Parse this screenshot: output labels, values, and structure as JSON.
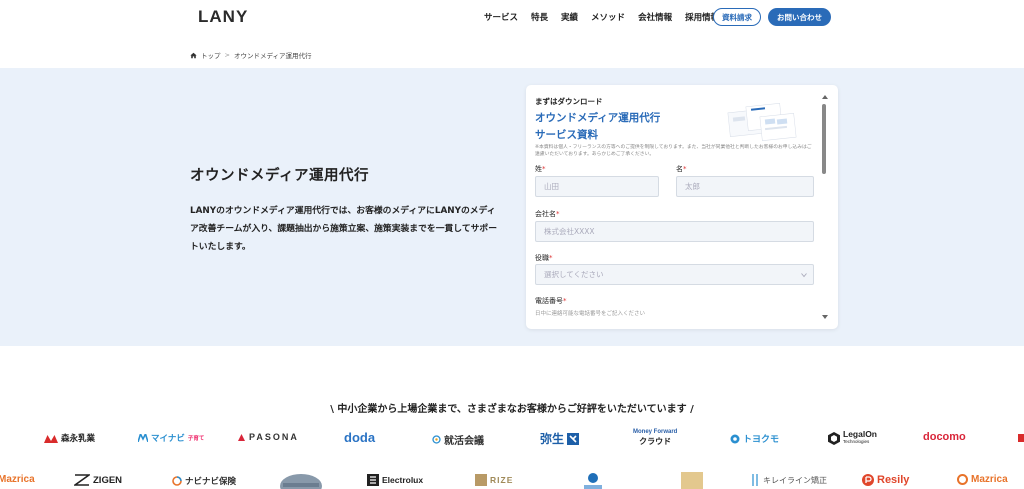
{
  "header": {
    "logo": "LANY",
    "nav": [
      "サービス",
      "特長",
      "実績",
      "メソッド",
      "会社情報",
      "採用情報"
    ],
    "btn_download": "資料請求",
    "btn_contact": "お問い合わせ",
    "accent": "#2a6bb8"
  },
  "breadcrumb": {
    "home": "トップ",
    "separator": ">",
    "current": "オウンドメディア運用代行"
  },
  "hero": {
    "title": "オウンドメディア運用代行",
    "description": "LANYのオウンドメディア運用代行では、お客様のメディアにLANYのメディア改善チームが入り、課題抽出から施策立案、施策実装までを一貫してサポートいたします。",
    "background": "#eaf1fa"
  },
  "form": {
    "kicker": "まずはダウンロード",
    "title_line1": "オウンドメディア運用代行",
    "title_line2": "サービス資料",
    "note": "※本資料は個人・フリーランスの方等へのご提供を制限しております。また、当社が同業他社と判断したお客様のお申し込みはご遠慮いただいております。あらかじめご了承ください。",
    "last_name_label": "姓",
    "last_name_placeholder": "山田",
    "first_name_label": "名",
    "first_name_placeholder": "太郎",
    "company_label": "会社名",
    "company_placeholder": "株式会社XXXX",
    "position_label": "役職",
    "position_placeholder": "選択してください",
    "phone_label": "電話番号",
    "phone_hint": "日中に連絡可能な電話番号をご記入ください",
    "required_mark": "*"
  },
  "clients": {
    "title": "\\ 中小企業から上場企業まで、さまざまなお客様からご好評をいただいています /",
    "row1": [
      {
        "name": "森永乳業",
        "color": "#d92b2b",
        "icon": "morinaga-mark"
      },
      {
        "name": "マイナビ",
        "color": "#2a8fd0",
        "icon": "mynavi-mark",
        "sub": "子育て"
      },
      {
        "name": "PASONA",
        "color": "#333333",
        "icon": "pasona-mark"
      },
      {
        "name": "doda",
        "color": "#2a73c4",
        "icon": ""
      },
      {
        "name": "就活会議",
        "color": "#333333",
        "icon": "circle-mark"
      },
      {
        "name": "弥生",
        "color": "#1d5fa8",
        "icon": "yayoi-mark"
      },
      {
        "name": "Money Forward",
        "color": "#2a5fa8",
        "icon": "",
        "sub": "クラウド"
      },
      {
        "name": "トヨクモ",
        "color": "#2a8fd0",
        "icon": "toyokumo-mark"
      },
      {
        "name": "LegalOn",
        "color": "#222222",
        "icon": "legalon-mark",
        "sub": "Technologies"
      },
      {
        "name": "docomo",
        "color": "#d9263a",
        "icon": ""
      }
    ],
    "row2": [
      {
        "name": "Mazrica",
        "color": "#e8732a",
        "icon": ""
      },
      {
        "name": "ZIGEN",
        "color": "#222222",
        "icon": "zigen-mark"
      },
      {
        "name": "ナビナビ保険",
        "color": "#333333",
        "icon": "navinavi-mark"
      },
      {
        "name": "Electrolux",
        "color": "#222222",
        "icon": "electrolux-mark"
      },
      {
        "name": "RIZE",
        "color": "#a08a58",
        "icon": "rize-mark"
      },
      {
        "name": "キレイライン矯正",
        "color": "#555555",
        "icon": "kireiline-mark"
      },
      {
        "name": "Resily",
        "color": "#e0462b",
        "icon": "resily-mark"
      },
      {
        "name": "Mazrica",
        "color": "#e8732a",
        "icon": "mazrica-mark"
      }
    ]
  }
}
